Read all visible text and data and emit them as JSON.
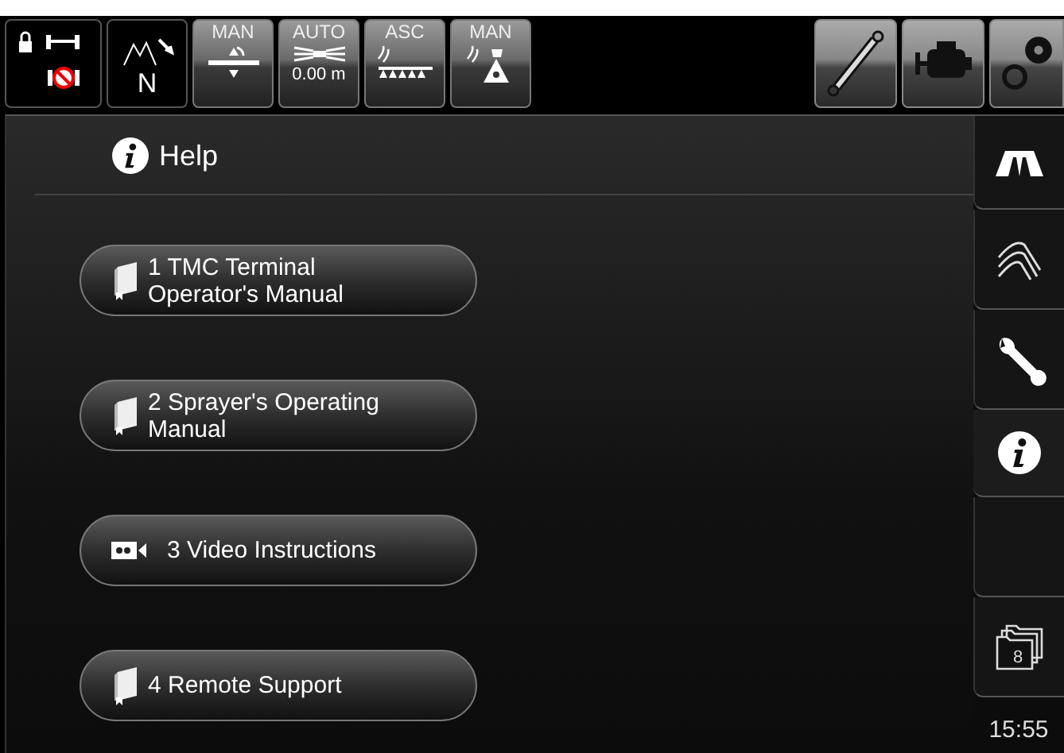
{
  "top_tiles": [
    {
      "kind": "lock"
    },
    {
      "kind": "compass",
      "label": "N"
    },
    {
      "kind": "height",
      "mode": "MAN"
    },
    {
      "kind": "auto",
      "mode": "AUTO",
      "reading": "0.00 m"
    },
    {
      "kind": "asc",
      "mode": "ASC"
    },
    {
      "kind": "nozzle",
      "mode": "MAN"
    }
  ],
  "top_buttons": [
    {
      "kind": "cylinder"
    },
    {
      "kind": "engine"
    },
    {
      "kind": "gears"
    }
  ],
  "header": {
    "title": "Help"
  },
  "manual_buttons": [
    {
      "kind": "book",
      "label": "1 TMC Terminal Operator's Manual"
    },
    {
      "kind": "book",
      "label": "2 Sprayer's Operating Manual"
    },
    {
      "kind": "video",
      "label": "3 Video Instructions"
    },
    {
      "kind": "book",
      "label": "4 Remote Support"
    }
  ],
  "side_tabs": [
    {
      "kind": "boom",
      "selected": false
    },
    {
      "kind": "track",
      "selected": false
    },
    {
      "kind": "wrench",
      "selected": false
    },
    {
      "kind": "info",
      "selected": true
    },
    {
      "kind": "empty",
      "selected": false
    },
    {
      "kind": "folder",
      "selected": false,
      "count": "8"
    }
  ],
  "clock": "15:55"
}
